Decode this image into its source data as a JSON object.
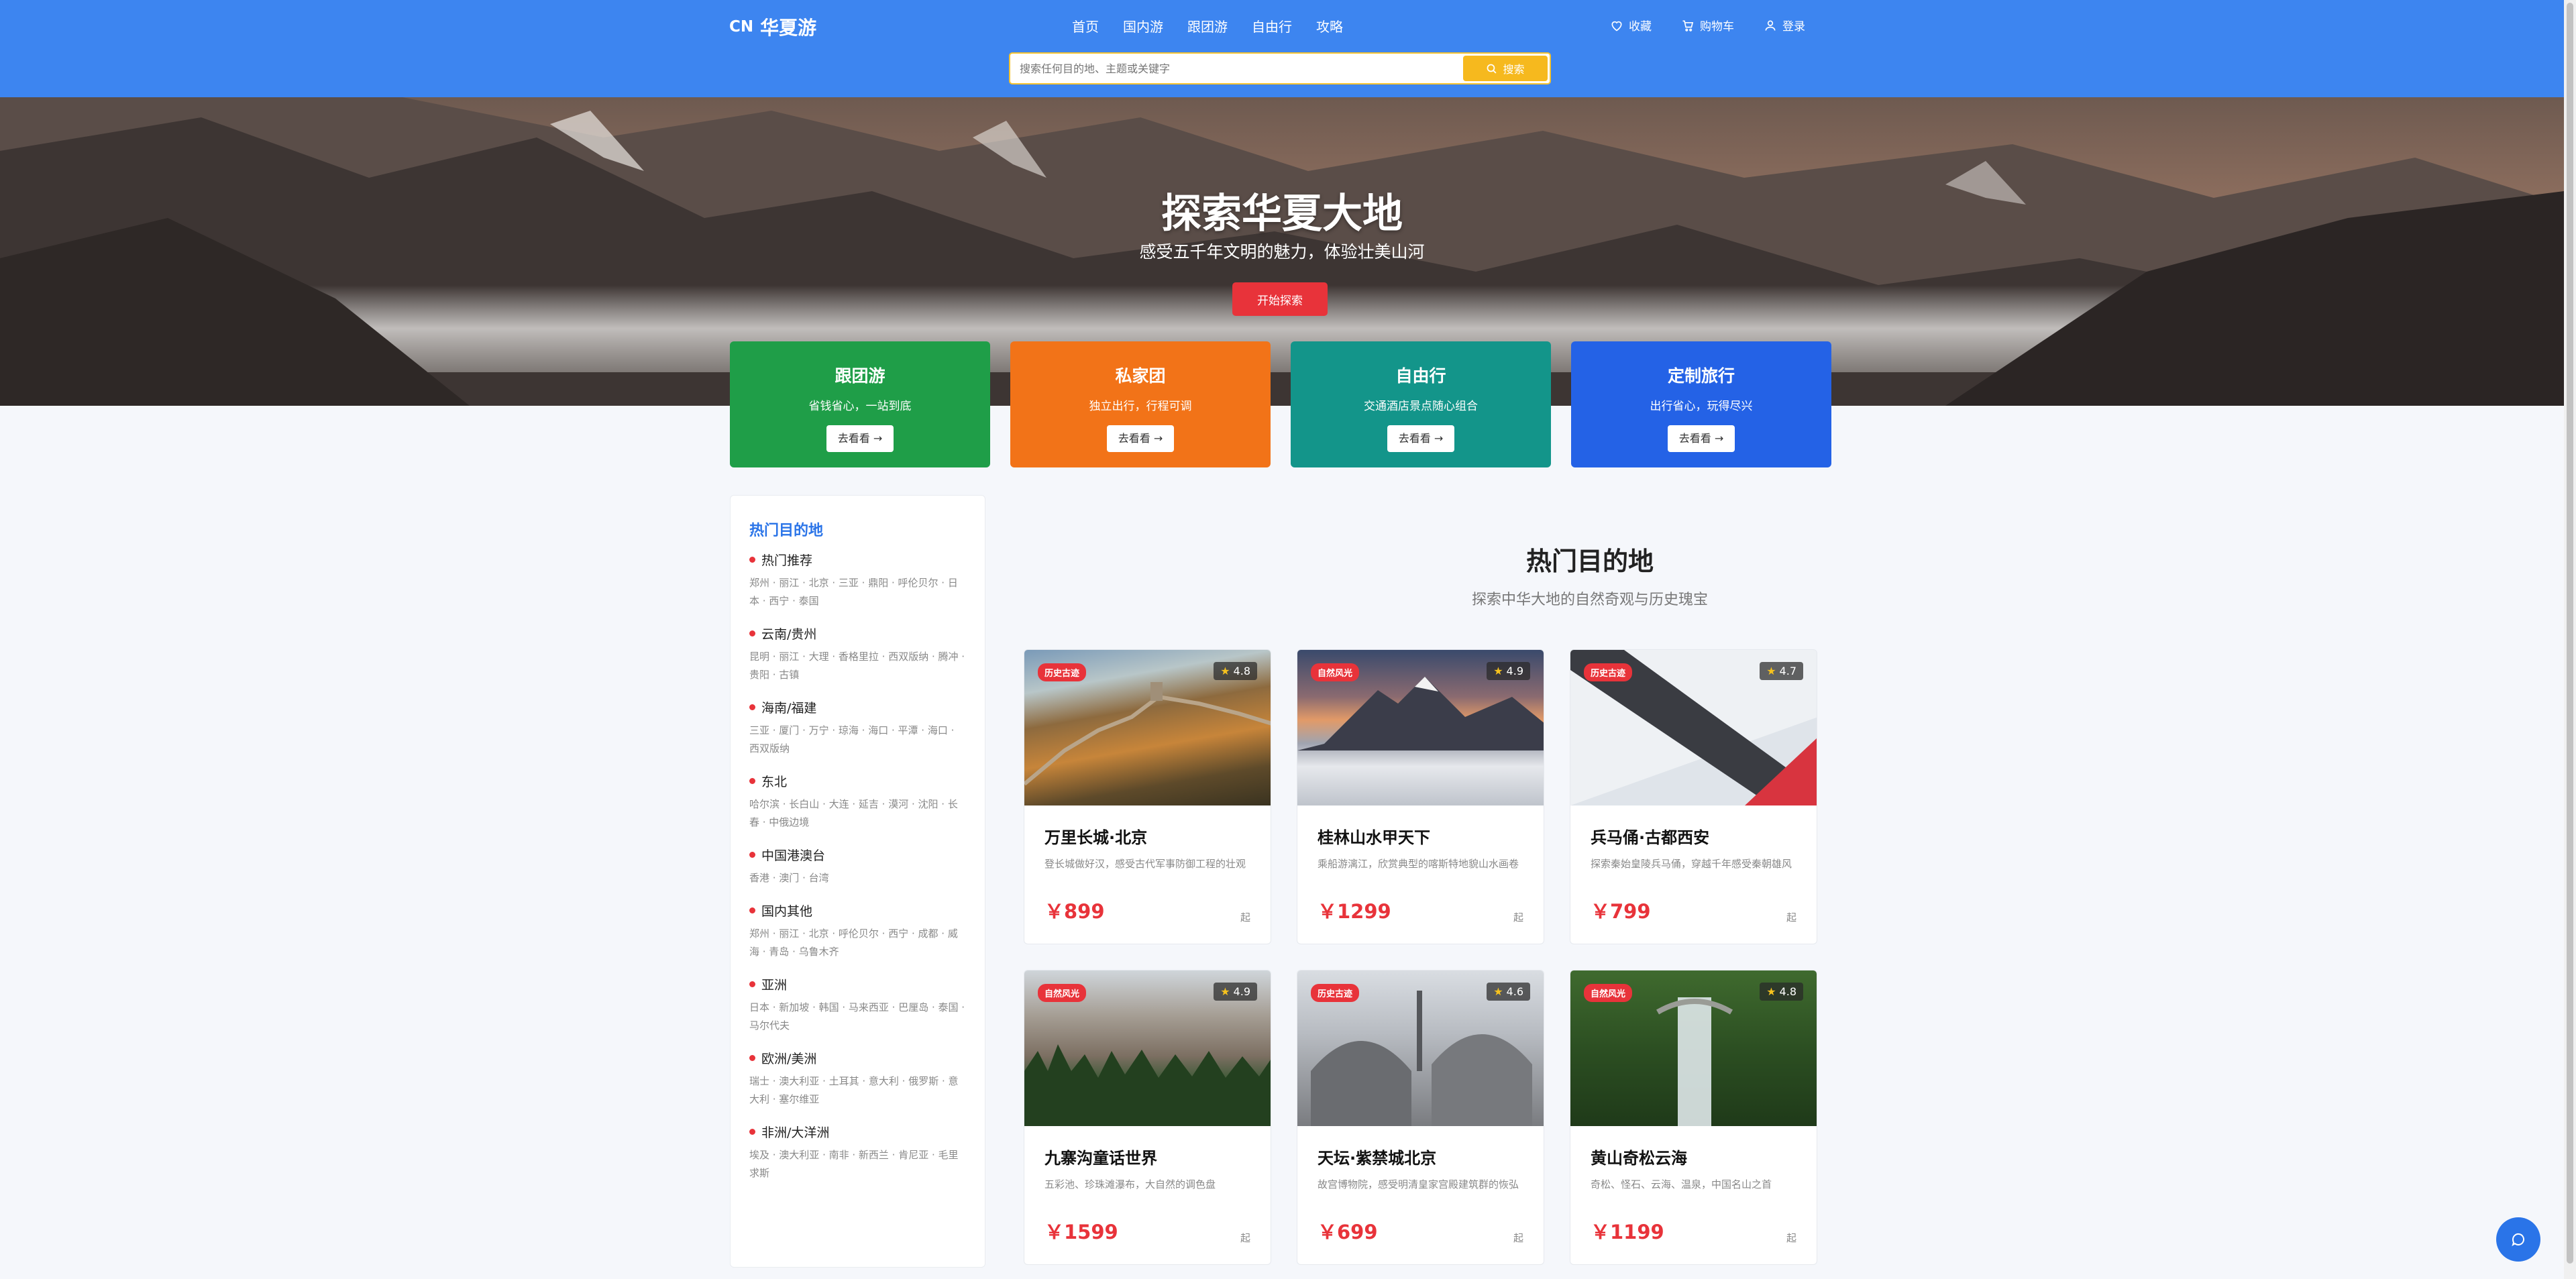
{
  "header": {
    "logo_mark": "CN",
    "logo_text": "华夏游",
    "nav": [
      "首页",
      "国内游",
      "跟团游",
      "自由行",
      "攻略"
    ],
    "actions": [
      {
        "icon": "heart-icon",
        "label": "收藏"
      },
      {
        "icon": "cart-icon",
        "label": "购物车"
      },
      {
        "icon": "user-icon",
        "label": "登录"
      }
    ],
    "search": {
      "placeholder": "搜索任何目的地、主题或关键字",
      "button": "搜索"
    }
  },
  "hero": {
    "title": "探索华夏大地",
    "subtitle": "感受五千年文明的魅力，体验壮美山河",
    "button": "开始探索"
  },
  "categories": [
    {
      "title": "跟团游",
      "subtitle": "省钱省心，一站到底",
      "button": "去看看 →",
      "color": "#1f9e48"
    },
    {
      "title": "私家团",
      "subtitle": "独立出行，行程可调",
      "button": "去看看 →",
      "color": "#f27318"
    },
    {
      "title": "自由行",
      "subtitle": "交通酒店景点随心组合",
      "button": "去看看 →",
      "color": "#13958a"
    },
    {
      "title": "定制旅行",
      "subtitle": "出行省心，玩得尽兴",
      "button": "去看看 →",
      "color": "#2462e6"
    }
  ],
  "sidebar": {
    "title": "热门目的地",
    "groups": [
      {
        "name": "热门推荐",
        "items": "郑州 · 丽江 · 北京 · 三亚 · 鼎阳 · 呼伦贝尔 · 日本 · 西宁 · 泰国"
      },
      {
        "name": "云南/贵州",
        "items": "昆明 · 丽江 · 大理 · 香格里拉 · 西双版纳 · 腾冲 · 贵阳 · 古镇"
      },
      {
        "name": "海南/福建",
        "items": "三亚 · 厦门 · 万宁 · 琼海 · 海口 · 平潭 · 海口 · 西双版纳"
      },
      {
        "name": "东北",
        "items": "哈尔滨 · 长白山 · 大连 · 延吉 · 漠河 · 沈阳 · 长春 · 中俄边境"
      },
      {
        "name": "中国港澳台",
        "items": "香港 · 澳门 · 台湾"
      },
      {
        "name": "国内其他",
        "items": "郑州 · 丽江 · 北京 · 呼伦贝尔 · 西宁 · 成都 · 威海 · 青岛 · 乌鲁木齐"
      },
      {
        "name": "亚洲",
        "items": "日本 · 新加坡 · 韩国 · 马来西亚 · 巴厘岛 · 泰国 · 马尔代夫"
      },
      {
        "name": "欧洲/美洲",
        "items": "瑞士 · 澳大利亚 · 土耳其 · 意大利 · 俄罗斯 · 意大利 · 塞尔维亚"
      },
      {
        "name": "非洲/大洋洲",
        "items": "埃及 · 澳大利亚 · 南非 · 新西兰 · 肯尼亚 · 毛里求斯"
      }
    ]
  },
  "section": {
    "title": "热门目的地",
    "subtitle": "探索中华大地的自然奇观与历史瑰宝"
  },
  "cards": [
    {
      "tag": "历史古迹",
      "rating": "4.8",
      "title": "万里长城·北京",
      "desc": "登长城做好汉，感受古代军事防御工程的壮观",
      "price": "￥899",
      "from": "起"
    },
    {
      "tag": "自然风光",
      "rating": "4.9",
      "title": "桂林山水甲天下",
      "desc": "乘船游漓江，欣赏典型的喀斯特地貌山水画卷",
      "price": "￥1299",
      "from": "起"
    },
    {
      "tag": "历史古迹",
      "rating": "4.7",
      "title": "兵马俑·古都西安",
      "desc": "探索秦始皇陵兵马俑，穿越千年感受秦朝雄风",
      "price": "￥799",
      "from": "起"
    },
    {
      "tag": "自然风光",
      "rating": "4.9",
      "title": "九寨沟童话世界",
      "desc": "五彩池、珍珠滩瀑布，大自然的调色盘",
      "price": "￥1599",
      "from": "起"
    },
    {
      "tag": "历史古迹",
      "rating": "4.6",
      "title": "天坛·紫禁城北京",
      "desc": "故宫博物院，感受明清皇家宫殿建筑群的恢弘",
      "price": "￥699",
      "from": "起"
    },
    {
      "tag": "自然风光",
      "rating": "4.8",
      "title": "黄山奇松云海",
      "desc": "奇松、怪石、云海、温泉，中国名山之首",
      "price": "￥1199",
      "from": "起"
    }
  ]
}
